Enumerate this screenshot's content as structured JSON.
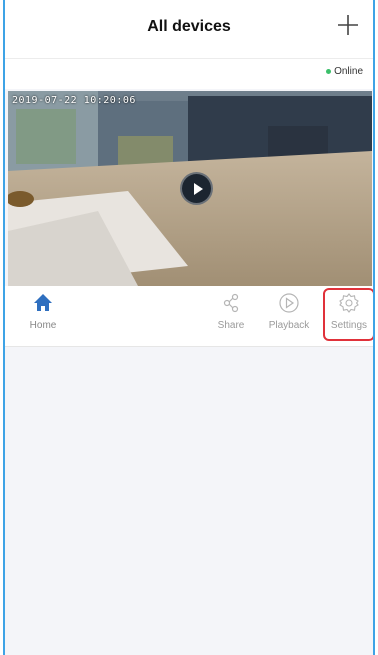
{
  "header": {
    "title": "All devices",
    "add_icon": "plus-icon"
  },
  "device": {
    "status": "Online",
    "status_color": "#3bbf6a",
    "timestamp": "2019-07-22  10:20:06",
    "play_icon": "play-icon"
  },
  "toolbar": {
    "items": [
      {
        "label": "Home",
        "icon": "home-icon",
        "color": "#2f6fbf"
      },
      {
        "label": "Share",
        "icon": "share-icon"
      },
      {
        "label": "Playback",
        "icon": "playback-icon"
      },
      {
        "label": "Settings",
        "icon": "gear-icon"
      }
    ],
    "highlight_color": "#e0313a"
  },
  "colors": {
    "frame_border": "#3ea3e6",
    "background": "#f4f5f9"
  }
}
